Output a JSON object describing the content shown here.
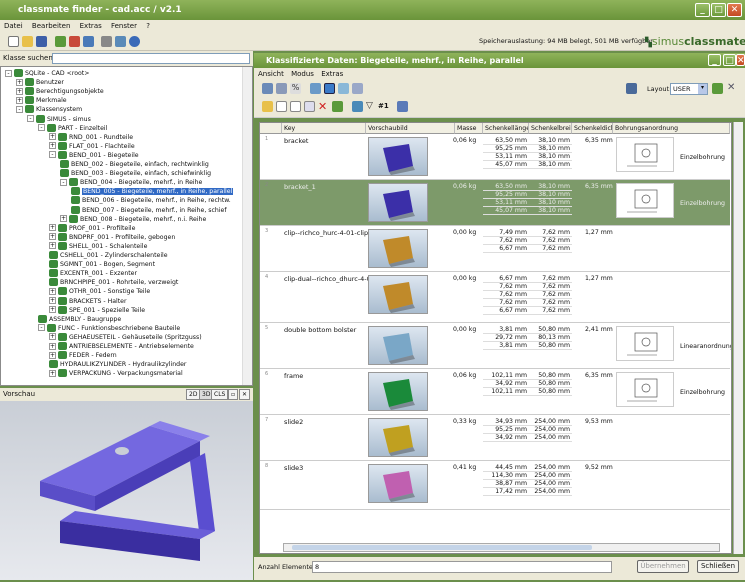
{
  "app": {
    "title": "classmate finder - cad.acc / v2.1"
  },
  "menu": [
    "Datei",
    "Bearbeiten",
    "Extras",
    "Fenster",
    "?"
  ],
  "memory_status": "Speicherauslastung: 94 MB belegt, 501 MB verfügbar",
  "brand": {
    "simus": "simus",
    "classmate": "classmate"
  },
  "search": {
    "label": "Klasse suchen:",
    "value": ""
  },
  "tree": [
    {
      "label": "SQLite - CAD <root>",
      "lvl": 0,
      "ex": "-"
    },
    {
      "label": "Benutzer",
      "lvl": 1,
      "ex": "+"
    },
    {
      "label": "Berechtigungsobjekte",
      "lvl": 1,
      "ex": "+"
    },
    {
      "label": "Merkmale",
      "lvl": 1,
      "ex": "+"
    },
    {
      "label": "Klassensystem",
      "lvl": 1,
      "ex": "-"
    },
    {
      "label": "SIMUS - simus",
      "lvl": 2,
      "ex": "-"
    },
    {
      "label": "PART - Einzelteil",
      "lvl": 3,
      "ex": "-"
    },
    {
      "label": "RND_001 - Rundteile",
      "lvl": 4,
      "ex": "+"
    },
    {
      "label": "FLAT_001 - Flachteile",
      "lvl": 4,
      "ex": "+"
    },
    {
      "label": "BEND_001 - Biegeteile",
      "lvl": 4,
      "ex": "-"
    },
    {
      "label": "BEND_002 - Biegeteile, einfach, rechtwinklig",
      "lvl": 5,
      "ex": ""
    },
    {
      "label": "BEND_003 - Biegeteile, einfach, schiefwinklig",
      "lvl": 5,
      "ex": ""
    },
    {
      "label": "BEND_004 - Biegeteile, mehrf., in Reihe",
      "lvl": 5,
      "ex": "-"
    },
    {
      "label": "BEND_005 - Biegeteile, mehrf., in Reihe, parallel",
      "lvl": 6,
      "ex": "",
      "sel": true
    },
    {
      "label": "BEND_006 - Biegeteile, mehrf., in Reihe, rechtw.",
      "lvl": 6,
      "ex": ""
    },
    {
      "label": "BEND_007 - Biegeteile, mehrf., in Reihe, schief",
      "lvl": 6,
      "ex": ""
    },
    {
      "label": "BEND_008 - Biegeteile, mehrf., n.i. Reihe",
      "lvl": 5,
      "ex": "+"
    },
    {
      "label": "PROF_001 - Profilteile",
      "lvl": 4,
      "ex": "+"
    },
    {
      "label": "BNDPRF_001 - Profilteile, gebogen",
      "lvl": 4,
      "ex": "+"
    },
    {
      "label": "SHELL_001 - Schalenteile",
      "lvl": 4,
      "ex": "+"
    },
    {
      "label": "CSHELL_001 - Zylinderschalenteile",
      "lvl": 4,
      "ex": ""
    },
    {
      "label": "SGMNT_001 - Bogen, Segment",
      "lvl": 4,
      "ex": ""
    },
    {
      "label": "EXCENTR_001 - Exzenter",
      "lvl": 4,
      "ex": ""
    },
    {
      "label": "BRNCHPIPE_001 - Rohrteile, verzweigt",
      "lvl": 4,
      "ex": ""
    },
    {
      "label": "OTHR_001 - Sonstige Teile",
      "lvl": 4,
      "ex": "+"
    },
    {
      "label": "BRACKETS - Halter",
      "lvl": 4,
      "ex": "+"
    },
    {
      "label": "SPE_001 - Spezielle Teile",
      "lvl": 4,
      "ex": "+"
    },
    {
      "label": "ASSEMBLY - Baugruppe",
      "lvl": 3,
      "ex": ""
    },
    {
      "label": "FUNC - Funktionsbeschriebene Bauteile",
      "lvl": 3,
      "ex": "-"
    },
    {
      "label": "GEHAEUSETEIL - Gehäuseteile (Spritzguss)",
      "lvl": 4,
      "ex": "+"
    },
    {
      "label": "ANTRIEBSELEMENTE - Antriebselemente",
      "lvl": 4,
      "ex": "+"
    },
    {
      "label": "FEDER - Federn",
      "lvl": 4,
      "ex": "+"
    },
    {
      "label": "HYDRAULIKZYLINDER - Hydraulikzylinder",
      "lvl": 4,
      "ex": ""
    },
    {
      "label": "VERPACKUNG - Verpackungsmaterial",
      "lvl": 4,
      "ex": "+"
    }
  ],
  "preview": {
    "label": "Vorschau",
    "btns": [
      "2D",
      "3D",
      "CLS"
    ]
  },
  "right": {
    "title": "Klassifizierte Daten: Biegeteile, mehrf., in Reihe, parallel",
    "menu": [
      "Ansicht",
      "Modus",
      "Extras"
    ],
    "layout_label": "Layout:",
    "layout_value": "USER"
  },
  "columns": [
    "Key",
    "Vorschaubild",
    "Masse",
    "Schenkellänge",
    "Schenkelbreite",
    "Schenkeldicke",
    "Bohrungsanordnung"
  ],
  "rows": [
    {
      "num": "1",
      "key": "bracket",
      "masse": "0,06 kg",
      "len": [
        "63,50 mm",
        "95,25 mm",
        "53,11 mm",
        "45,07 mm"
      ],
      "brt": [
        "38,10 mm",
        "38,10 mm",
        "38,10 mm",
        "38,10 mm"
      ],
      "dicke": "6,35 mm",
      "anord": "Einzelbohrung",
      "draw": true,
      "color": "#3b2fa8"
    },
    {
      "num": "2",
      "key": "bracket_1",
      "masse": "0,06 kg",
      "len": [
        "63,50 mm",
        "95,25 mm",
        "53,11 mm",
        "45,07 mm"
      ],
      "brt": [
        "38,10 mm",
        "38,10 mm",
        "38,10 mm",
        "38,10 mm"
      ],
      "dicke": "6,35 mm",
      "anord": "Einzelbohrung",
      "draw": true,
      "color": "#3b2fa8",
      "sel": true
    },
    {
      "num": "3",
      "key": "clip--richco_hurc-4-01-clip",
      "masse": "0,00 kg",
      "len": [
        "7,49 mm",
        "7,62 mm",
        "6,67 mm"
      ],
      "brt": [
        "7,62 mm",
        "7,62 mm",
        "7,62 mm"
      ],
      "dicke": "1,27 mm",
      "anord": "",
      "draw": false,
      "color": "#c08a2a"
    },
    {
      "num": "4",
      "key": "clip-dual--richco_dhurc-4-01",
      "masse": "0,00 kg",
      "len": [
        "6,67 mm",
        "7,62 mm",
        "7,62 mm",
        "7,62 mm",
        "6,67 mm"
      ],
      "brt": [
        "7,62 mm",
        "7,62 mm",
        "7,62 mm",
        "7,62 mm",
        "7,62 mm"
      ],
      "dicke": "1,27 mm",
      "anord": "",
      "draw": false,
      "color": "#c08a2a"
    },
    {
      "num": "5",
      "key": "double bottom bolster",
      "masse": "0,00 kg",
      "len": [
        "3,81 mm",
        "29,72 mm",
        "3,81 mm"
      ],
      "brt": [
        "50,80 mm",
        "80,13 mm",
        "50,80 mm"
      ],
      "dicke": "2,41 mm",
      "anord": "Linearanordnung",
      "draw": true,
      "color": "#7aa7c7"
    },
    {
      "num": "6",
      "key": "frame",
      "masse": "0,06 kg",
      "len": [
        "102,11 mm",
        "34,92 mm",
        "102,11 mm"
      ],
      "brt": [
        "50,80 mm",
        "50,80 mm",
        "50,80 mm"
      ],
      "dicke": "6,35 mm",
      "anord": "Einzelbohrung",
      "draw": true,
      "color": "#1a8a3a"
    },
    {
      "num": "7",
      "key": "slide2",
      "masse": "0,33 kg",
      "len": [
        "34,93 mm",
        "95,25 mm",
        "34,92 mm"
      ],
      "brt": [
        "254,00 mm",
        "254,00 mm",
        "254,00 mm"
      ],
      "dicke": "9,53 mm",
      "anord": "",
      "draw": false,
      "color": "#c0a020"
    },
    {
      "num": "8",
      "key": "slide3",
      "masse": "0,41 kg",
      "len": [
        "44,45 mm",
        "114,30 mm",
        "38,87 mm",
        "17,42 mm"
      ],
      "brt": [
        "254,00 mm",
        "254,00 mm",
        "254,00 mm",
        "254,00 mm"
      ],
      "dicke": "9,52 mm",
      "anord": "",
      "draw": false,
      "color": "#c060b0"
    }
  ],
  "status": {
    "label": "Anzahl Elemente:",
    "value": "8",
    "apply": "Übernehmen",
    "close": "Schließen"
  }
}
